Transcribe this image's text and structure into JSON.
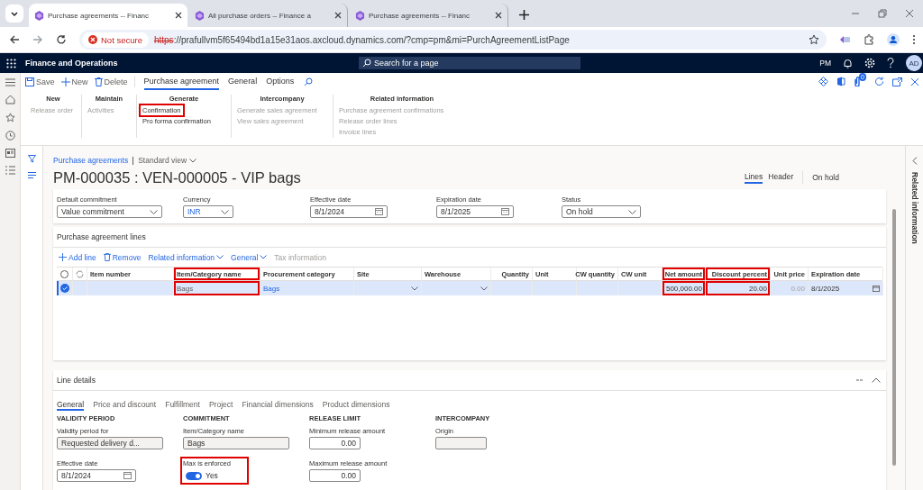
{
  "browser": {
    "tabs": [
      {
        "title": "Purchase agreements -- Financ",
        "selected": true
      },
      {
        "title": "All purchase orders -- Finance a",
        "selected": false
      },
      {
        "title": "Purchase agreements -- Financ",
        "selected": false
      }
    ],
    "security": "Not secure",
    "url_scheme": "https",
    "url_rest": "://prafullvm5f65494bd1a15e31aos.axcloud.dynamics.com/?cmp=pm&mi=PurchAgreementListPage"
  },
  "navbar": {
    "app_name": "Finance and Operations",
    "search_placeholder": "Search for a page",
    "company": "PM",
    "avatar": "AD"
  },
  "action_bar": {
    "buttons": [
      {
        "label": "Save"
      },
      {
        "label": "New"
      },
      {
        "label": "Delete"
      }
    ],
    "tabs": [
      {
        "label": "Purchase agreement",
        "selected": true
      },
      {
        "label": "General",
        "selected": false
      },
      {
        "label": "Options",
        "selected": false
      }
    ],
    "attachments_count": "0"
  },
  "ribbon": {
    "groups": [
      {
        "title": "New",
        "items": [
          {
            "label": "Release order",
            "disabled": true,
            "highlighted": false
          }
        ]
      },
      {
        "title": "Maintain",
        "items": [
          {
            "label": "Activities",
            "disabled": true,
            "highlighted": false
          }
        ]
      },
      {
        "title": "Generate",
        "items": [
          {
            "label": "Confirmation",
            "disabled": false,
            "highlighted": true
          },
          {
            "label": "Pro forma confirmation",
            "disabled": false,
            "highlighted": false
          }
        ]
      },
      {
        "title": "Intercompany",
        "items": [
          {
            "label": "Generate sales agreement",
            "disabled": true,
            "highlighted": false
          },
          {
            "label": "View sales agreement",
            "disabled": true,
            "highlighted": false
          }
        ]
      },
      {
        "title": "Related information",
        "items": [
          {
            "label": "Purchase agreement confirmations",
            "disabled": true,
            "highlighted": false
          },
          {
            "label": "Release order lines",
            "disabled": true,
            "highlighted": false
          },
          {
            "label": "Invoice lines",
            "disabled": true,
            "highlighted": false
          }
        ]
      }
    ]
  },
  "page": {
    "breadcrumb": "Purchase agreements",
    "view": "Standard view",
    "title": "PM-000035 : VEN-000005 - VIP bags",
    "tabs": [
      {
        "label": "Lines",
        "selected": true
      },
      {
        "label": "Header",
        "selected": false
      }
    ],
    "status_label": "On hold"
  },
  "header_fields": [
    {
      "label": "Default commitment",
      "value": "Value commitment",
      "kind": "dropdown"
    },
    {
      "label": "Currency",
      "value": "INR",
      "kind": "lookup"
    },
    {
      "label": "Effective date",
      "value": "8/1/2024",
      "kind": "date"
    },
    {
      "label": "Expiration date",
      "value": "8/1/2025",
      "kind": "date"
    },
    {
      "label": "Status",
      "value": "On hold",
      "kind": "dropdown"
    }
  ],
  "lines": {
    "title": "Purchase agreement lines",
    "toolbar": [
      {
        "label": "Add line",
        "disabled": false
      },
      {
        "label": "Remove",
        "disabled": false
      },
      {
        "label": "Related information",
        "disabled": false
      },
      {
        "label": "General",
        "disabled": false
      },
      {
        "label": "Tax information",
        "disabled": true
      }
    ],
    "all_selected": false,
    "columns": [
      {
        "label": "Item number",
        "numeric": false,
        "highlighted": false
      },
      {
        "label": "Item/Category name",
        "numeric": false,
        "highlighted": true
      },
      {
        "label": "Procurement category",
        "numeric": false,
        "highlighted": false
      },
      {
        "label": "Site",
        "numeric": false,
        "highlighted": false
      },
      {
        "label": "Warehouse",
        "numeric": false,
        "highlighted": false
      },
      {
        "label": "Quantity",
        "numeric": true,
        "highlighted": false
      },
      {
        "label": "Unit",
        "numeric": false,
        "highlighted": false
      },
      {
        "label": "CW quantity",
        "numeric": true,
        "highlighted": false
      },
      {
        "label": "CW unit",
        "numeric": false,
        "highlighted": false
      },
      {
        "label": "Net amount",
        "numeric": true,
        "highlighted": true
      },
      {
        "label": "Discount percent",
        "numeric": true,
        "highlighted": true
      },
      {
        "label": "Unit price",
        "numeric": true,
        "highlighted": false
      },
      {
        "label": "Expiration date",
        "numeric": false,
        "highlighted": false
      }
    ],
    "rows": [
      {
        "selected": true,
        "cells": [
          {
            "kind": "text"
          },
          {
            "kind": "text",
            "text": "Bags"
          },
          {
            "kind": "link",
            "text": "Bags"
          },
          {
            "kind": "dropdown"
          },
          {
            "kind": "dropdown"
          },
          {
            "kind": "text"
          },
          {
            "kind": "text"
          },
          {
            "kind": "text"
          },
          {
            "kind": "text"
          },
          {
            "kind": "number",
            "text": "500,000.00"
          },
          {
            "kind": "number",
            "text": "20.00"
          },
          {
            "kind": "muted",
            "text": "0.00"
          },
          {
            "kind": "date",
            "text": "8/1/2025"
          }
        ]
      }
    ]
  },
  "line_details": {
    "title": "Line details",
    "tabs": [
      {
        "label": "General",
        "selected": true
      },
      {
        "label": "Price and discount",
        "selected": false
      },
      {
        "label": "Fulfillment",
        "selected": false
      },
      {
        "label": "Project",
        "selected": false
      },
      {
        "label": "Financial dimensions",
        "selected": false
      },
      {
        "label": "Product dimensions",
        "selected": false
      }
    ],
    "groups": [
      {
        "title": "VALIDITY PERIOD",
        "fields": [
          {
            "label": "Validity period for",
            "value": "Requested delivery d...",
            "kind": "readonly",
            "highlighted": false
          },
          {
            "label": "Effective date",
            "value": "8/1/2024",
            "kind": "date",
            "highlighted": false
          }
        ]
      },
      {
        "title": "COMMITMENT",
        "fields": [
          {
            "label": "Item/Category name",
            "value": "Bags",
            "kind": "readonly",
            "highlighted": false
          },
          {
            "label": "Max is enforced",
            "value": "Yes",
            "kind": "toggle",
            "on": true,
            "highlighted": true
          }
        ]
      },
      {
        "title": "RELEASE LIMIT",
        "fields": [
          {
            "label": "Minimum release amount",
            "value": "0.00",
            "kind": "number",
            "highlighted": false
          },
          {
            "label": "Maximum release amount",
            "value": "0.00",
            "kind": "number",
            "highlighted": false
          }
        ]
      },
      {
        "title": "INTERCOMPANY",
        "fields": [
          {
            "label": "Origin",
            "kind": "readonly",
            "highlighted": false
          }
        ]
      }
    ]
  },
  "side_panel": {
    "title": "Related information"
  }
}
